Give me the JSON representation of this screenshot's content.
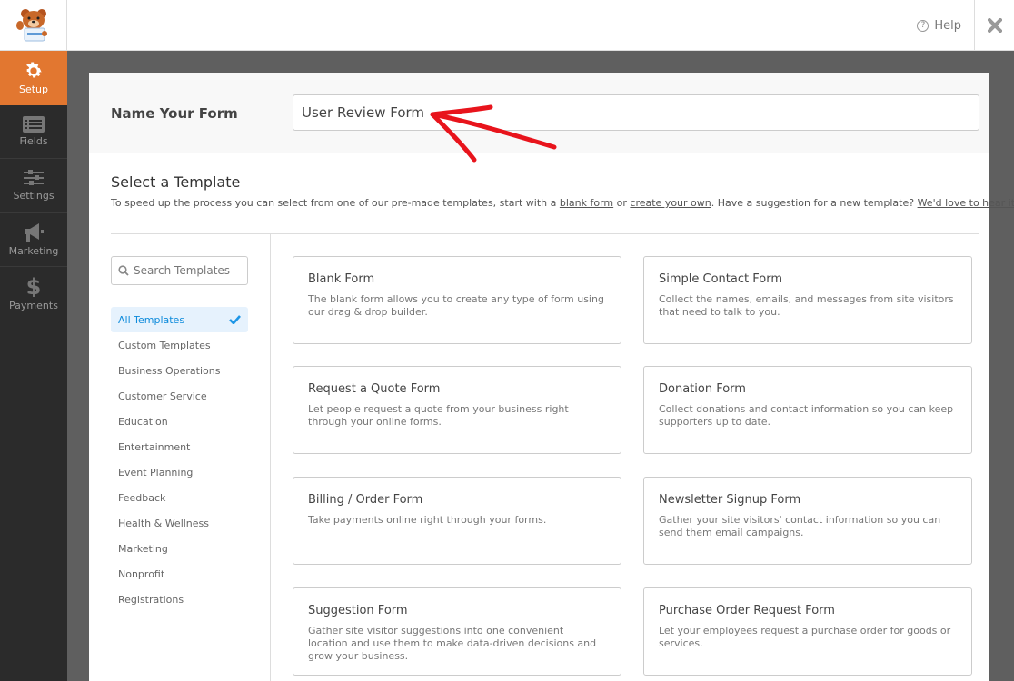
{
  "header": {
    "logo": "wpforms-bear-logo",
    "help_label": "Help",
    "help_icon": "question-circle-icon",
    "close_icon": "close-icon"
  },
  "sidebar": {
    "items": [
      {
        "label": "Setup",
        "icon": "gear-icon",
        "active": true
      },
      {
        "label": "Fields",
        "icon": "list-icon",
        "active": false
      },
      {
        "label": "Settings",
        "icon": "sliders-icon",
        "active": false
      },
      {
        "label": "Marketing",
        "icon": "megaphone-icon",
        "active": false
      },
      {
        "label": "Payments",
        "icon": "dollar-icon",
        "active": false
      }
    ]
  },
  "form_name": {
    "label": "Name Your Form",
    "value": "User Review Form"
  },
  "templates_section": {
    "title": "Select a Template",
    "desc_prefix": "To speed up the process you can select from one of our pre-made templates, start with a ",
    "blank_link": "blank form",
    "or_text": " or ",
    "create_link": "create your own",
    "desc_middle": ". Have a suggestion for a new template? ",
    "hear_link": "We'd love to hear it",
    "desc_suffix": "!"
  },
  "search": {
    "placeholder": "Search Templates"
  },
  "categories": [
    {
      "label": "All Templates",
      "active": true
    },
    {
      "label": "Custom Templates"
    },
    {
      "label": "Business Operations"
    },
    {
      "label": "Customer Service"
    },
    {
      "label": "Education"
    },
    {
      "label": "Entertainment"
    },
    {
      "label": "Event Planning"
    },
    {
      "label": "Feedback"
    },
    {
      "label": "Health & Wellness"
    },
    {
      "label": "Marketing"
    },
    {
      "label": "Nonprofit"
    },
    {
      "label": "Registrations"
    }
  ],
  "templates": [
    {
      "title": "Blank Form",
      "desc": "The blank form allows you to create any type of form using our drag & drop builder."
    },
    {
      "title": "Simple Contact Form",
      "desc": "Collect the names, emails, and messages from site visitors that need to talk to you."
    },
    {
      "title": "Request a Quote Form",
      "desc": "Let people request a quote from your business right through your online forms."
    },
    {
      "title": "Donation Form",
      "desc": "Collect donations and contact information so you can keep supporters up to date."
    },
    {
      "title": "Billing / Order Form",
      "desc": "Take payments online right through your forms."
    },
    {
      "title": "Newsletter Signup Form",
      "desc": "Gather your site visitors' contact information so you can send them email campaigns."
    },
    {
      "title": "Suggestion Form",
      "desc": "Gather site visitor suggestions into one convenient location and use them to make data-driven decisions and grow your business."
    },
    {
      "title": "Purchase Order Request Form",
      "desc": "Let your employees request a purchase order for goods or services."
    }
  ],
  "colors": {
    "accent_orange": "#e27730",
    "active_blue": "#0e8bdb",
    "annotation_red": "#e8141c"
  }
}
